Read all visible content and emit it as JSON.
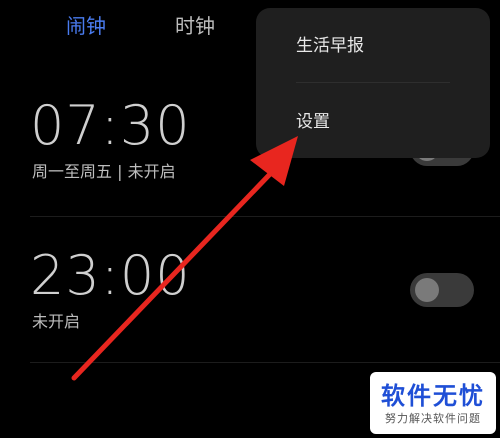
{
  "tabs": {
    "alarm": "闹钟",
    "clock": "时钟"
  },
  "alarms": [
    {
      "time": "07:30",
      "desc": "周一至周五 | 未开启",
      "enabled": false
    },
    {
      "time": "23:00",
      "desc": "未开启",
      "enabled": false
    }
  ],
  "menu": {
    "item1": "生活早报",
    "item2": "设置"
  },
  "watermark": {
    "title": "软件无忧",
    "subtitle": "努力解决软件问题"
  },
  "colors": {
    "accent": "#4a7cf0",
    "arrow": "#e8261f",
    "background": "#000000"
  }
}
